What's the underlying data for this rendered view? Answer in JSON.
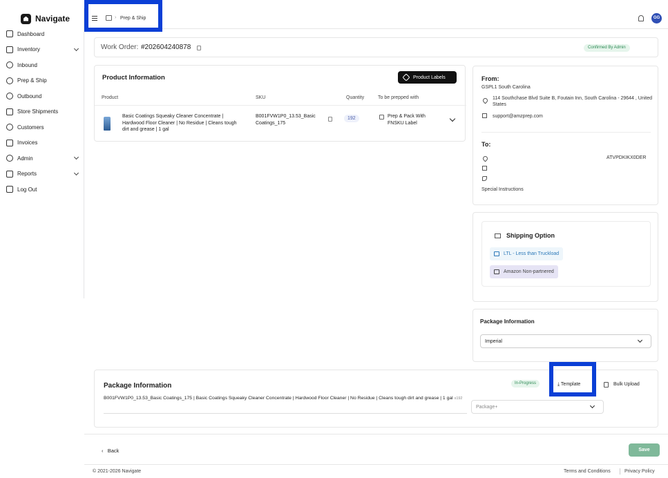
{
  "brand": {
    "name": "Navigate"
  },
  "sidebar": {
    "items": [
      {
        "label": "Dashboard",
        "icon": "home-icon"
      },
      {
        "label": "Inventory",
        "icon": "inventory-icon",
        "expandable": true
      },
      {
        "label": "Inbound",
        "icon": "inbound-icon"
      },
      {
        "label": "Prep & Ship",
        "icon": "box-icon"
      },
      {
        "label": "Outbound",
        "icon": "outbound-icon"
      },
      {
        "label": "Store Shipments",
        "icon": "store-icon"
      },
      {
        "label": "Customers",
        "icon": "users-icon"
      },
      {
        "label": "Invoices",
        "icon": "invoice-icon"
      },
      {
        "label": "Admin",
        "icon": "admin-icon",
        "expandable": true
      },
      {
        "label": "Reports",
        "icon": "report-icon",
        "expandable": true
      },
      {
        "label": "Log Out",
        "icon": "logout-icon"
      }
    ]
  },
  "header": {
    "breadcrumb": "Prep & Ship",
    "avatar_initials": "GG"
  },
  "work_order": {
    "label": "Work Order:",
    "number": "#202604240878",
    "status": "Confirmed By Admin"
  },
  "product_info": {
    "title": "Product Information",
    "labels_button": "Product Labels",
    "columns": [
      "Product",
      "SKU",
      "Quantity",
      "To be prepped with"
    ],
    "row": {
      "product": "Basic Coatings Squeaky Cleaner Concentrate | Hardwood Floor Cleaner | No Residue | Cleans tough dirt and grease | 1 gal",
      "sku": "B001FVW1P0_13.53_Basic Coatings_175",
      "quantity": "192",
      "prep": "Prep & Pack With FNSKU Label"
    }
  },
  "from": {
    "heading": "From:",
    "name": "GSPL1 South Carolina",
    "address": "114 Southchase Blvd Suite B, Foutain Inn, South Carolina - 29644 , United States",
    "email": "support@amzprep.com"
  },
  "to": {
    "heading": "To:",
    "code": "ATVPDKIKX0DER",
    "special": "Special Instructions"
  },
  "shipping": {
    "title": "Shipping Option",
    "option1": "LTL - Less than Truckload",
    "option2": "Amazon Non-partnered"
  },
  "package_right": {
    "title": "Package Information",
    "unit": "Imperial"
  },
  "package_bottom": {
    "title": "Package Information",
    "status": "In-Progress",
    "template": "Template",
    "bulk": "Bulk Upload",
    "description": "B001FVW1P0_13.53_Basic Coatings_175 | Basic Coatings Squeaky Cleaner Concentrate | Hardwood Floor Cleaner | No Residue | Cleans tough dirt and grease | 1 gal",
    "qty_suffix": "x192",
    "package_placeholder": "Package+"
  },
  "actions": {
    "back": "Back",
    "save": "Save"
  },
  "footer": {
    "copyright": "© 2021-2026 Navigate",
    "terms": "Terms and Conditions",
    "privacy": "Privacy Policy"
  },
  "colors": {
    "accent": "#0a3fd6",
    "save": "#7fb99a",
    "avatar": "#2f4fb5",
    "success": "#2e8a55"
  }
}
